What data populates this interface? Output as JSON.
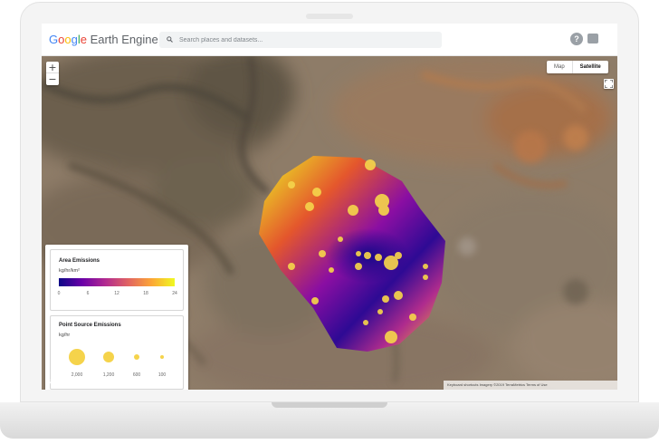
{
  "app": {
    "brand_letters": [
      "G",
      "o",
      "o",
      "g",
      "l",
      "e"
    ],
    "brand_suffix": " Earth Engine",
    "search_placeholder": "Search places and datasets..."
  },
  "map_controls": {
    "zoom_in": "+",
    "zoom_out": "−",
    "map_label": "Map",
    "satellite_label": "Satellite",
    "active_type": "Satellite"
  },
  "attribution": {
    "text": "Keyboard shortcuts   Imagery ©2019 TerraMetrics   Terms of Use",
    "logo": "Google"
  },
  "legend": {
    "area": {
      "title": "Area Emissions",
      "unit": "kg/hr/km²",
      "ticks": [
        "0",
        "6",
        "12",
        "18",
        "24"
      ],
      "ramp_colors": [
        "#0d0887",
        "#6a00a8",
        "#b12a90",
        "#e16462",
        "#fca636",
        "#f0f921"
      ]
    },
    "points": {
      "title": "Point Source Emissions",
      "unit": "kg/hr",
      "labels": [
        "2,000",
        "1,200",
        "600",
        "100"
      ],
      "color": "#f5d34b"
    }
  },
  "icons": {
    "search": "search-icon",
    "help": "help-icon",
    "feedback": "feedback-icon",
    "fullscreen": "fullscreen-icon"
  }
}
